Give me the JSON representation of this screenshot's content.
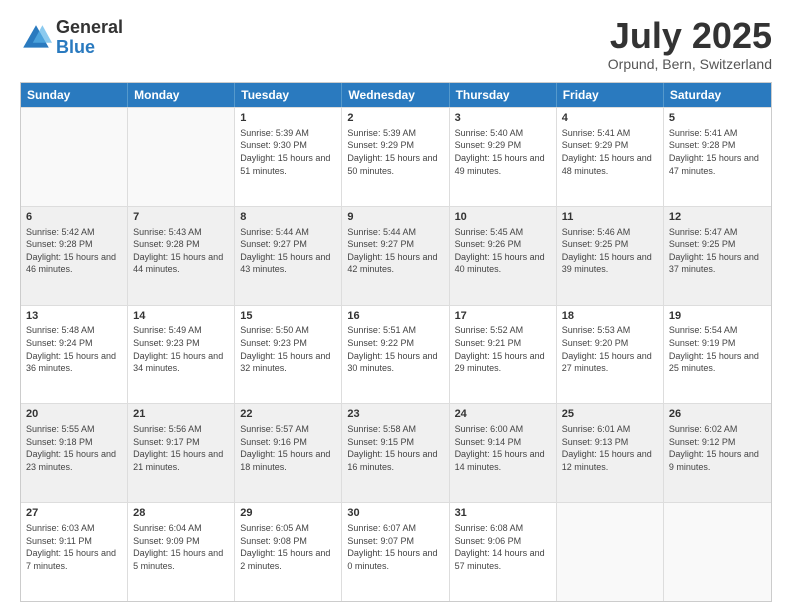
{
  "logo": {
    "general": "General",
    "blue": "Blue"
  },
  "title": "July 2025",
  "location": "Orpund, Bern, Switzerland",
  "days_of_week": [
    "Sunday",
    "Monday",
    "Tuesday",
    "Wednesday",
    "Thursday",
    "Friday",
    "Saturday"
  ],
  "weeks": [
    [
      {
        "day": "",
        "sunrise": "",
        "sunset": "",
        "daylight": "",
        "empty": true
      },
      {
        "day": "",
        "sunrise": "",
        "sunset": "",
        "daylight": "",
        "empty": true
      },
      {
        "day": "1",
        "sunrise": "Sunrise: 5:39 AM",
        "sunset": "Sunset: 9:30 PM",
        "daylight": "Daylight: 15 hours and 51 minutes."
      },
      {
        "day": "2",
        "sunrise": "Sunrise: 5:39 AM",
        "sunset": "Sunset: 9:29 PM",
        "daylight": "Daylight: 15 hours and 50 minutes."
      },
      {
        "day": "3",
        "sunrise": "Sunrise: 5:40 AM",
        "sunset": "Sunset: 9:29 PM",
        "daylight": "Daylight: 15 hours and 49 minutes."
      },
      {
        "day": "4",
        "sunrise": "Sunrise: 5:41 AM",
        "sunset": "Sunset: 9:29 PM",
        "daylight": "Daylight: 15 hours and 48 minutes."
      },
      {
        "day": "5",
        "sunrise": "Sunrise: 5:41 AM",
        "sunset": "Sunset: 9:28 PM",
        "daylight": "Daylight: 15 hours and 47 minutes."
      }
    ],
    [
      {
        "day": "6",
        "sunrise": "Sunrise: 5:42 AM",
        "sunset": "Sunset: 9:28 PM",
        "daylight": "Daylight: 15 hours and 46 minutes."
      },
      {
        "day": "7",
        "sunrise": "Sunrise: 5:43 AM",
        "sunset": "Sunset: 9:28 PM",
        "daylight": "Daylight: 15 hours and 44 minutes."
      },
      {
        "day": "8",
        "sunrise": "Sunrise: 5:44 AM",
        "sunset": "Sunset: 9:27 PM",
        "daylight": "Daylight: 15 hours and 43 minutes."
      },
      {
        "day": "9",
        "sunrise": "Sunrise: 5:44 AM",
        "sunset": "Sunset: 9:27 PM",
        "daylight": "Daylight: 15 hours and 42 minutes."
      },
      {
        "day": "10",
        "sunrise": "Sunrise: 5:45 AM",
        "sunset": "Sunset: 9:26 PM",
        "daylight": "Daylight: 15 hours and 40 minutes."
      },
      {
        "day": "11",
        "sunrise": "Sunrise: 5:46 AM",
        "sunset": "Sunset: 9:25 PM",
        "daylight": "Daylight: 15 hours and 39 minutes."
      },
      {
        "day": "12",
        "sunrise": "Sunrise: 5:47 AM",
        "sunset": "Sunset: 9:25 PM",
        "daylight": "Daylight: 15 hours and 37 minutes."
      }
    ],
    [
      {
        "day": "13",
        "sunrise": "Sunrise: 5:48 AM",
        "sunset": "Sunset: 9:24 PM",
        "daylight": "Daylight: 15 hours and 36 minutes."
      },
      {
        "day": "14",
        "sunrise": "Sunrise: 5:49 AM",
        "sunset": "Sunset: 9:23 PM",
        "daylight": "Daylight: 15 hours and 34 minutes."
      },
      {
        "day": "15",
        "sunrise": "Sunrise: 5:50 AM",
        "sunset": "Sunset: 9:23 PM",
        "daylight": "Daylight: 15 hours and 32 minutes."
      },
      {
        "day": "16",
        "sunrise": "Sunrise: 5:51 AM",
        "sunset": "Sunset: 9:22 PM",
        "daylight": "Daylight: 15 hours and 30 minutes."
      },
      {
        "day": "17",
        "sunrise": "Sunrise: 5:52 AM",
        "sunset": "Sunset: 9:21 PM",
        "daylight": "Daylight: 15 hours and 29 minutes."
      },
      {
        "day": "18",
        "sunrise": "Sunrise: 5:53 AM",
        "sunset": "Sunset: 9:20 PM",
        "daylight": "Daylight: 15 hours and 27 minutes."
      },
      {
        "day": "19",
        "sunrise": "Sunrise: 5:54 AM",
        "sunset": "Sunset: 9:19 PM",
        "daylight": "Daylight: 15 hours and 25 minutes."
      }
    ],
    [
      {
        "day": "20",
        "sunrise": "Sunrise: 5:55 AM",
        "sunset": "Sunset: 9:18 PM",
        "daylight": "Daylight: 15 hours and 23 minutes."
      },
      {
        "day": "21",
        "sunrise": "Sunrise: 5:56 AM",
        "sunset": "Sunset: 9:17 PM",
        "daylight": "Daylight: 15 hours and 21 minutes."
      },
      {
        "day": "22",
        "sunrise": "Sunrise: 5:57 AM",
        "sunset": "Sunset: 9:16 PM",
        "daylight": "Daylight: 15 hours and 18 minutes."
      },
      {
        "day": "23",
        "sunrise": "Sunrise: 5:58 AM",
        "sunset": "Sunset: 9:15 PM",
        "daylight": "Daylight: 15 hours and 16 minutes."
      },
      {
        "day": "24",
        "sunrise": "Sunrise: 6:00 AM",
        "sunset": "Sunset: 9:14 PM",
        "daylight": "Daylight: 15 hours and 14 minutes."
      },
      {
        "day": "25",
        "sunrise": "Sunrise: 6:01 AM",
        "sunset": "Sunset: 9:13 PM",
        "daylight": "Daylight: 15 hours and 12 minutes."
      },
      {
        "day": "26",
        "sunrise": "Sunrise: 6:02 AM",
        "sunset": "Sunset: 9:12 PM",
        "daylight": "Daylight: 15 hours and 9 minutes."
      }
    ],
    [
      {
        "day": "27",
        "sunrise": "Sunrise: 6:03 AM",
        "sunset": "Sunset: 9:11 PM",
        "daylight": "Daylight: 15 hours and 7 minutes."
      },
      {
        "day": "28",
        "sunrise": "Sunrise: 6:04 AM",
        "sunset": "Sunset: 9:09 PM",
        "daylight": "Daylight: 15 hours and 5 minutes."
      },
      {
        "day": "29",
        "sunrise": "Sunrise: 6:05 AM",
        "sunset": "Sunset: 9:08 PM",
        "daylight": "Daylight: 15 hours and 2 minutes."
      },
      {
        "day": "30",
        "sunrise": "Sunrise: 6:07 AM",
        "sunset": "Sunset: 9:07 PM",
        "daylight": "Daylight: 15 hours and 0 minutes."
      },
      {
        "day": "31",
        "sunrise": "Sunrise: 6:08 AM",
        "sunset": "Sunset: 9:06 PM",
        "daylight": "Daylight: 14 hours and 57 minutes."
      },
      {
        "day": "",
        "sunrise": "",
        "sunset": "",
        "daylight": "",
        "empty": true
      },
      {
        "day": "",
        "sunrise": "",
        "sunset": "",
        "daylight": "",
        "empty": true
      }
    ]
  ]
}
